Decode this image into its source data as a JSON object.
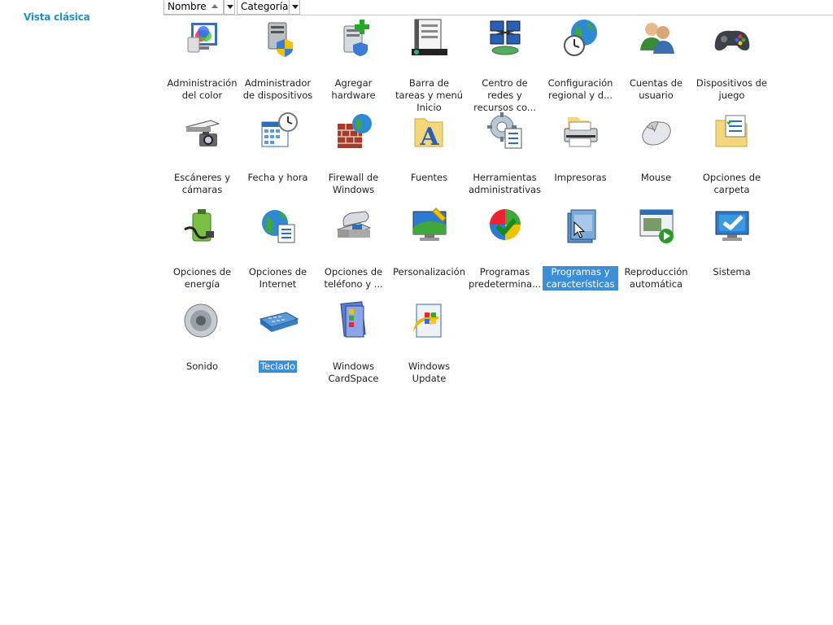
{
  "sidebar": {
    "classic_view": "Vista clásica"
  },
  "columns": {
    "name": "Nombre",
    "category": "Categoría"
  },
  "items": [
    {
      "label": "Administración del color",
      "icon": "color-management-icon",
      "col": 0,
      "row": 0
    },
    {
      "label": "Administrador de dispositivos",
      "icon": "device-manager-icon",
      "col": 1,
      "row": 0
    },
    {
      "label": "Agregar hardware",
      "icon": "add-hardware-icon",
      "col": 2,
      "row": 0
    },
    {
      "label": "Barra de tareas y menú Inicio",
      "icon": "taskbar-icon",
      "col": 3,
      "row": 0
    },
    {
      "label": "Centro de redes y recursos co...",
      "icon": "network-center-icon",
      "col": 4,
      "row": 0
    },
    {
      "label": "Configuración regional y d...",
      "icon": "regional-settings-icon",
      "col": 5,
      "row": 0
    },
    {
      "label": "Cuentas de usuario",
      "icon": "user-accounts-icon",
      "col": 6,
      "row": 0
    },
    {
      "label": "Dispositivos de juego",
      "icon": "game-controller-icon",
      "col": 7,
      "row": 0
    },
    {
      "label": "Escáneres y cámaras",
      "icon": "scanner-camera-icon",
      "col": 0,
      "row": 1
    },
    {
      "label": "Fecha y hora",
      "icon": "date-time-icon",
      "col": 1,
      "row": 1
    },
    {
      "label": "Firewall de Windows",
      "icon": "firewall-icon",
      "col": 2,
      "row": 1
    },
    {
      "label": "Fuentes",
      "icon": "fonts-folder-icon",
      "col": 3,
      "row": 1
    },
    {
      "label": "Herramientas administrativas",
      "icon": "admin-tools-icon",
      "col": 4,
      "row": 1
    },
    {
      "label": "Impresoras",
      "icon": "printer-icon",
      "col": 5,
      "row": 1
    },
    {
      "label": "Mouse",
      "icon": "mouse-icon",
      "col": 6,
      "row": 1
    },
    {
      "label": "Opciones de carpeta",
      "icon": "folder-options-icon",
      "col": 7,
      "row": 1
    },
    {
      "label": "Opciones de energía",
      "icon": "power-options-icon",
      "col": 0,
      "row": 2
    },
    {
      "label": "Opciones de Internet",
      "icon": "internet-options-icon",
      "col": 1,
      "row": 2
    },
    {
      "label": "Opciones de teléfono y ...",
      "icon": "phone-modem-icon",
      "col": 2,
      "row": 2
    },
    {
      "label": "Personalización",
      "icon": "personalization-icon",
      "col": 3,
      "row": 2
    },
    {
      "label": "Programas predetermina...",
      "icon": "default-programs-icon",
      "col": 4,
      "row": 2
    },
    {
      "label": "Programas y características",
      "icon": "programs-features-icon",
      "col": 5,
      "row": 2,
      "selected": true
    },
    {
      "label": "Reproducción automática",
      "icon": "autoplay-icon",
      "col": 6,
      "row": 2
    },
    {
      "label": "Sistema",
      "icon": "system-icon",
      "col": 7,
      "row": 2
    },
    {
      "label": "Sonido",
      "icon": "speaker-icon",
      "col": 0,
      "row": 3
    },
    {
      "label": "Teclado",
      "icon": "keyboard-icon",
      "col": 1,
      "row": 3,
      "selected": true
    },
    {
      "label": "Windows CardSpace",
      "icon": "cardspace-icon",
      "col": 2,
      "row": 3
    },
    {
      "label": "Windows Update",
      "icon": "windows-update-icon",
      "col": 3,
      "row": 3
    }
  ],
  "colors": {
    "accent": "#2a8fc6",
    "selection": "#3c8fd6"
  }
}
